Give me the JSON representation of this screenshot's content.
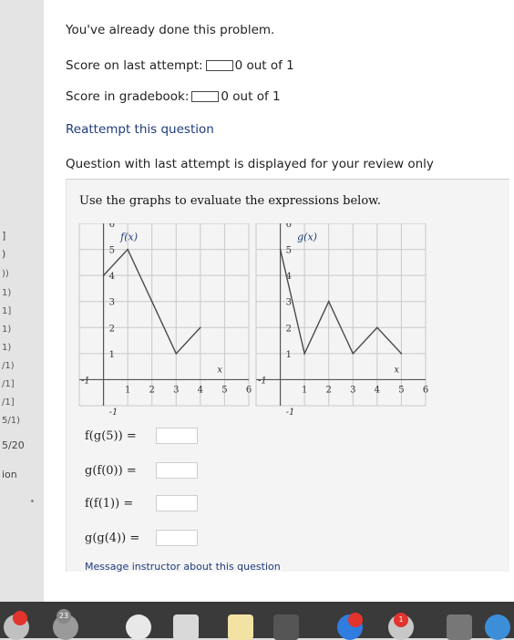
{
  "left_sidebar": {
    "items": [
      "]",
      ")",
      "))",
      "1)",
      "1]",
      "1)",
      "1)",
      "/1)",
      "/1]",
      "/1]",
      "5/1)",
      "5/20",
      "ion"
    ]
  },
  "header": {
    "done_notice": "You've already done this problem.",
    "last_attempt_label": "Score on last attempt:",
    "last_attempt_value": "0 out of 1",
    "gradebook_label": "Score in gradebook:",
    "gradebook_value": "0 out of 1",
    "reattempt_link": "Reattempt this question",
    "review_notice": "Question with last attempt is displayed for your review only"
  },
  "problem": {
    "instructions": "Use the graphs to evaluate the expressions below.",
    "message_link": "Message instructor about this question",
    "expressions": [
      {
        "label": "f(g(5)) =",
        "value": ""
      },
      {
        "label": "g(f(0)) =",
        "value": ""
      },
      {
        "label": "f(f(1)) =",
        "value": ""
      },
      {
        "label": "g(g(4)) =",
        "value": ""
      }
    ]
  },
  "chart_data": [
    {
      "type": "line",
      "title": "f(x)",
      "xlabel": "x",
      "ylabel": "",
      "xlim": [
        -1,
        6
      ],
      "ylim": [
        -1,
        6
      ],
      "grid": true,
      "x_ticks": [
        "1",
        "2",
        "3",
        "4",
        "5",
        "6"
      ],
      "y_ticks": [
        "1",
        "2",
        "3",
        "4",
        "5",
        "6"
      ],
      "x_neg_label": "-1",
      "y_neg_label": "-1",
      "series": [
        {
          "x": [
            0,
            1,
            2,
            3,
            4
          ],
          "y": [
            4,
            5,
            3,
            1,
            2
          ]
        }
      ]
    },
    {
      "type": "line",
      "title": "g(x)",
      "xlabel": "x",
      "ylabel": "",
      "xlim": [
        -1,
        6
      ],
      "ylim": [
        -1,
        6
      ],
      "grid": true,
      "x_ticks": [
        "1",
        "2",
        "3",
        "4",
        "5",
        "6"
      ],
      "y_ticks": [
        "1",
        "2",
        "3",
        "4",
        "5",
        "6"
      ],
      "x_neg_label": "-1",
      "y_neg_label": "-1",
      "series": [
        {
          "x": [
            0,
            1,
            2,
            3,
            4,
            5
          ],
          "y": [
            5,
            1,
            3,
            1,
            2,
            1
          ]
        }
      ]
    }
  ],
  "dock": {
    "badges": [
      "23",
      "1"
    ],
    "accent": "#e2332d"
  }
}
